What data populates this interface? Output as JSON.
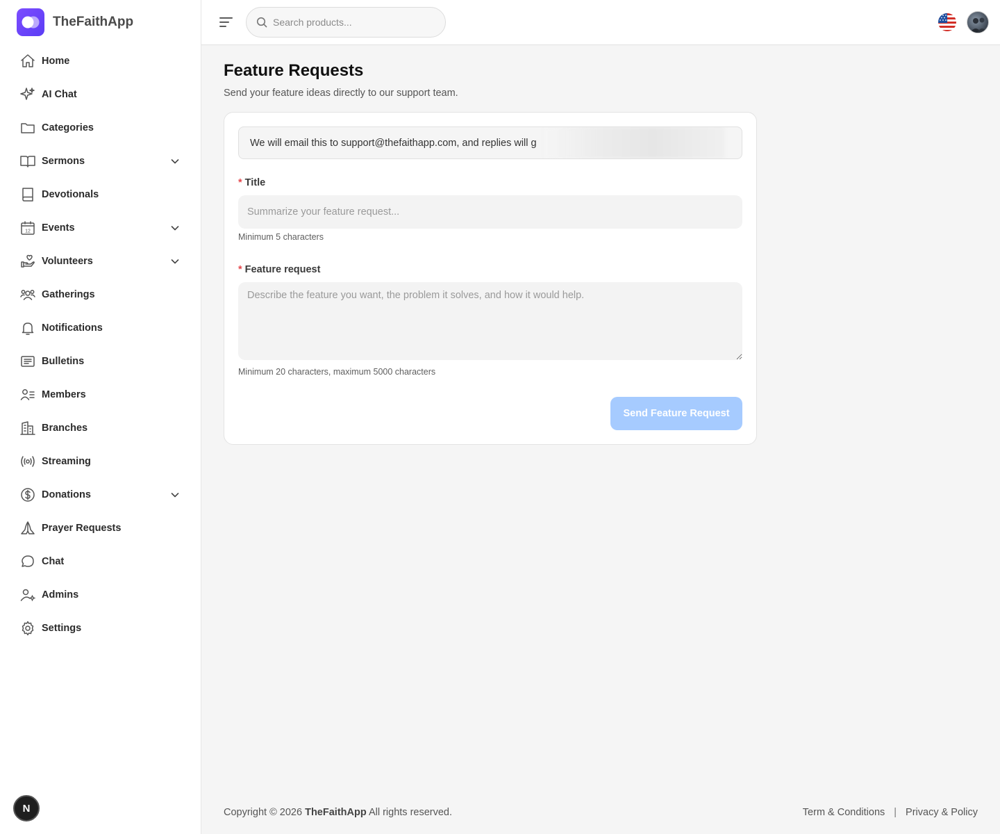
{
  "brand": {
    "name": "TheFaithApp",
    "accent": "#6c47ff"
  },
  "sidebar": {
    "items": [
      {
        "label": "Home",
        "icon": "home-icon",
        "expandable": false
      },
      {
        "label": "AI Chat",
        "icon": "sparkles-icon",
        "expandable": false
      },
      {
        "label": "Categories",
        "icon": "folder-icon",
        "expandable": false
      },
      {
        "label": "Sermons",
        "icon": "book-open-icon",
        "expandable": true
      },
      {
        "label": "Devotionals",
        "icon": "book-icon",
        "expandable": false
      },
      {
        "label": "Events",
        "icon": "calendar-icon",
        "expandable": true
      },
      {
        "label": "Volunteers",
        "icon": "hand-heart-icon",
        "expandable": true
      },
      {
        "label": "Gatherings",
        "icon": "users-icon",
        "expandable": false
      },
      {
        "label": "Notifications",
        "icon": "bell-icon",
        "expandable": false
      },
      {
        "label": "Bulletins",
        "icon": "newspaper-icon",
        "expandable": false
      },
      {
        "label": "Members",
        "icon": "user-list-icon",
        "expandable": false
      },
      {
        "label": "Branches",
        "icon": "building-icon",
        "expandable": false
      },
      {
        "label": "Streaming",
        "icon": "broadcast-icon",
        "expandable": false
      },
      {
        "label": "Donations",
        "icon": "dollar-circle-icon",
        "expandable": true
      },
      {
        "label": "Prayer Requests",
        "icon": "praying-hands-icon",
        "expandable": false
      },
      {
        "label": "Chat",
        "icon": "message-circle-icon",
        "expandable": false
      },
      {
        "label": "Admins",
        "icon": "user-cog-icon",
        "expandable": false
      },
      {
        "label": "Settings",
        "icon": "gear-icon",
        "expandable": false
      }
    ]
  },
  "topbar": {
    "search_placeholder": "Search products...",
    "language_icon": "us-flag-icon"
  },
  "page": {
    "title": "Feature Requests",
    "subtitle": "Send your feature ideas directly to our support team."
  },
  "form": {
    "notice_text": "We will email this to support@thefaithapp.com, and replies will g",
    "title_label": "Title",
    "title_placeholder": "Summarize your feature request...",
    "title_value": "",
    "title_hint": "Minimum 5 characters",
    "request_label": "Feature request",
    "request_placeholder": "Describe the feature you want, the problem it solves, and how it would help.",
    "request_value": "",
    "request_hint": "Minimum 20 characters, maximum 5000 characters",
    "submit_label": "Send Feature Request",
    "submit_disabled_color": "#a6cbff",
    "required_color": "#e5484d"
  },
  "footer": {
    "copyright_prefix": "Copyright © 2026",
    "copyright_brand": "TheFaithApp",
    "copyright_suffix": "All rights reserved.",
    "terms_label": "Term & Conditions",
    "separator": "|",
    "privacy_label": "Privacy & Policy"
  },
  "dev_badge": {
    "letter": "N"
  }
}
